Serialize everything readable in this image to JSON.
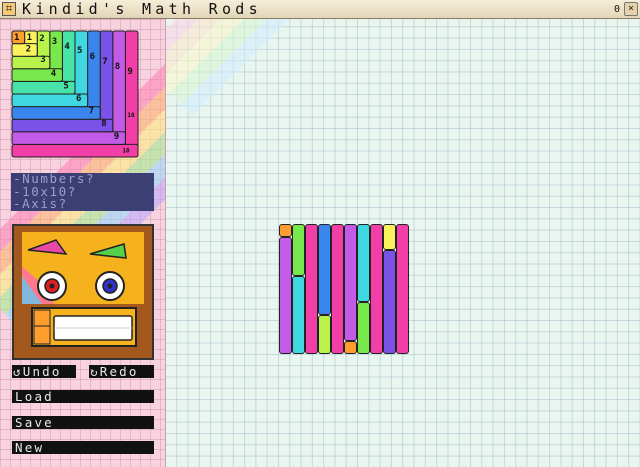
{
  "window": {
    "title": "Kindid's Math Rods",
    "app_icon": "app-icon",
    "control_glyph": "0",
    "close_glyph": "×"
  },
  "palette": {
    "labels": [
      "1",
      "1",
      "2",
      "3",
      "4",
      "5",
      "6",
      "7",
      "8",
      "9",
      "10"
    ],
    "rod_colors": {
      "1": "#ff9d2e",
      "2": "#f9f25a",
      "3": "#b9f24a",
      "4": "#78e84c",
      "5": "#47e3a8",
      "6": "#3fd7e0",
      "7": "#3a86ee",
      "8": "#7a52e8",
      "9": "#c35ae8",
      "10": "#f23fa7"
    }
  },
  "options": {
    "numbers": "-Numbers?",
    "grid": "-10x10?",
    "axis": "-Axis?"
  },
  "buttons": {
    "undo": "↺Undo",
    "redo": "↻Redo",
    "load": "Load",
    "save": "Save",
    "new": "New"
  },
  "workspace": {
    "rod_arrangement": [
      {
        "col": 0,
        "lengths": [
          1,
          9
        ]
      },
      {
        "col": 1,
        "lengths": [
          4,
          6
        ]
      },
      {
        "col": 2,
        "lengths": [
          10
        ]
      },
      {
        "col": 3,
        "lengths": [
          7,
          3
        ]
      },
      {
        "col": 4,
        "lengths": [
          10
        ]
      },
      {
        "col": 5,
        "lengths": [
          9,
          1
        ]
      },
      {
        "col": 6,
        "lengths": [
          6,
          4
        ]
      },
      {
        "col": 7,
        "lengths": [
          10
        ]
      },
      {
        "col": 8,
        "lengths": [
          2,
          8
        ]
      },
      {
        "col": 9,
        "lengths": [
          10
        ]
      }
    ]
  }
}
